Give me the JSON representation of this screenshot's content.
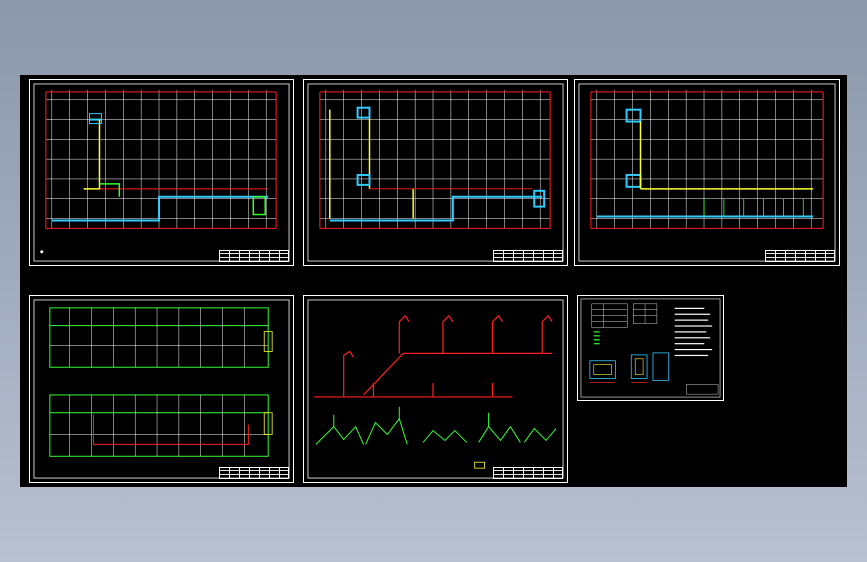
{
  "viewer": {
    "background_top": "#8b97aa",
    "background_bottom": "#b9c1d0",
    "canvas_color": "#000000"
  },
  "sheets": [
    {
      "id": "sheet-1",
      "title": "",
      "kind": "floor-plan"
    },
    {
      "id": "sheet-2",
      "title": "",
      "kind": "floor-plan"
    },
    {
      "id": "sheet-3",
      "title": "",
      "kind": "floor-plan"
    },
    {
      "id": "sheet-4",
      "title": "",
      "kind": "double-floor-plan"
    },
    {
      "id": "sheet-5",
      "title": "",
      "kind": "piping-isometric"
    },
    {
      "id": "sheet-6",
      "title": "",
      "kind": "notes-and-details"
    }
  ],
  "colors": {
    "grid_white": "#ffffff",
    "axis_red": "#ff2020",
    "pipe_cyan": "#33ccff",
    "pipe_yellow": "#ffff33",
    "pipe_green": "#33ff33",
    "pipe_magenta": "#ff33ff",
    "dim_red": "#ff3030"
  },
  "icons": {
    "north": "north-arrow-icon"
  }
}
